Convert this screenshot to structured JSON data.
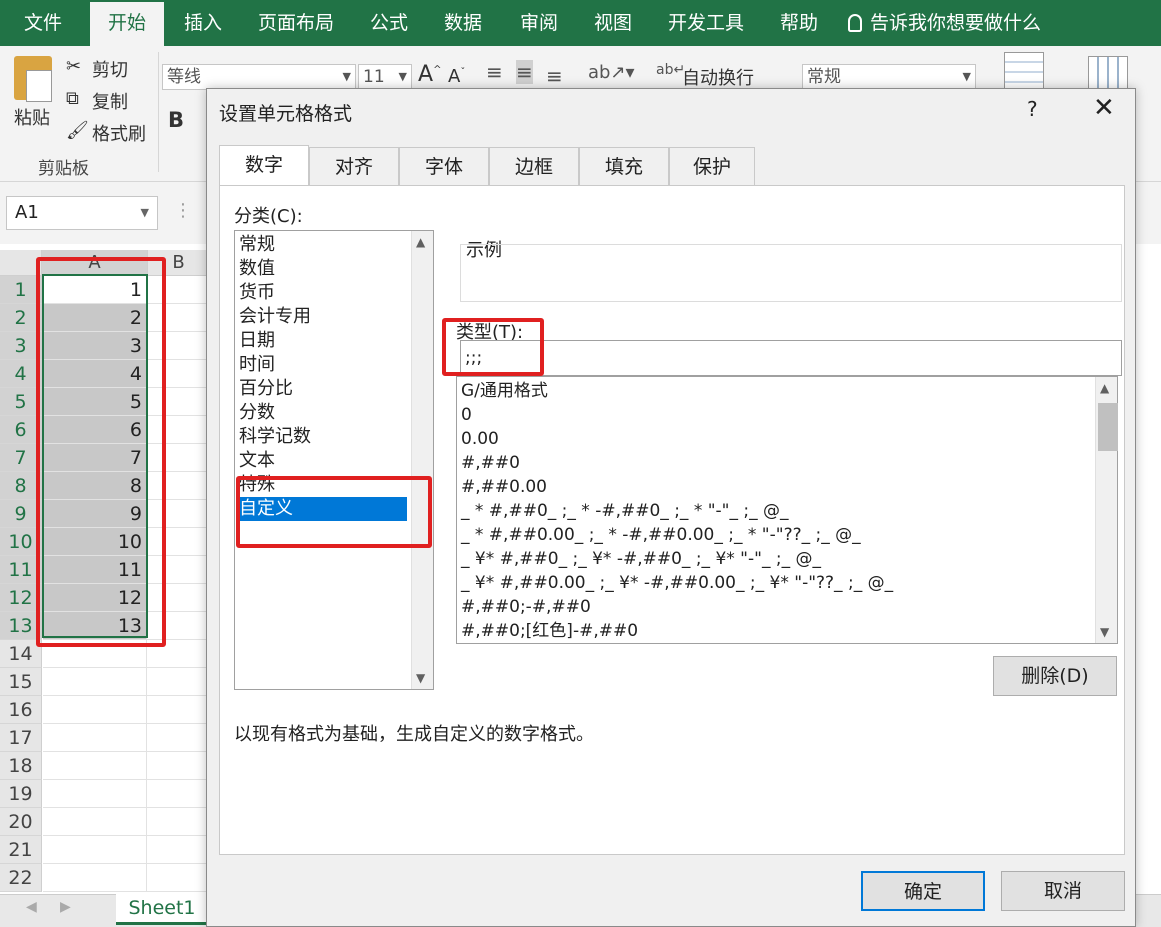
{
  "ribbon": {
    "tabs": [
      "文件",
      "开始",
      "插入",
      "页面布局",
      "公式",
      "数据",
      "审阅",
      "视图",
      "开发工具",
      "帮助"
    ],
    "active_tab": "开始",
    "tell_me": "告诉我你想要做什么",
    "paste_label": "粘贴",
    "cut_label": "剪切",
    "copy_label": "复制",
    "format_painter_label": "格式刷",
    "clipboard_group": "剪贴板",
    "font_name": "等线",
    "font_size": "11",
    "bold": "B",
    "wrap_text": "自动换行",
    "number_format": "常规"
  },
  "formula_bar": {
    "name_box": "A1"
  },
  "grid": {
    "col_a": "A",
    "col_b": "B",
    "rows": [
      "1",
      "2",
      "3",
      "4",
      "5",
      "6",
      "7",
      "8",
      "9",
      "10",
      "11",
      "12",
      "13",
      "14",
      "15",
      "16",
      "17",
      "18",
      "19",
      "20",
      "21",
      "22"
    ],
    "values": [
      "1",
      "2",
      "3",
      "4",
      "5",
      "6",
      "7",
      "8",
      "9",
      "10",
      "11",
      "12",
      "13"
    ]
  },
  "sheet_tab": "Sheet1",
  "dialog": {
    "title": "设置单元格格式",
    "help": "?",
    "tabs": [
      "数字",
      "对齐",
      "字体",
      "边框",
      "填充",
      "保护"
    ],
    "category_label": "分类(C):",
    "categories": [
      "常规",
      "数值",
      "货币",
      "会计专用",
      "日期",
      "时间",
      "百分比",
      "分数",
      "科学记数",
      "文本",
      "特殊",
      "自定义"
    ],
    "selected_category": "自定义",
    "sample_label": "示例",
    "type_label": "类型(T):",
    "type_value": ";;;",
    "formats": [
      "G/通用格式",
      "0",
      "0.00",
      "#,##0",
      "#,##0.00",
      "_ * #,##0_ ;_ * -#,##0_ ;_ * \"-\"_ ;_ @_",
      "_ * #,##0.00_ ;_ * -#,##0.00_ ;_ * \"-\"??_ ;_ @_",
      "_ ¥* #,##0_ ;_ ¥* -#,##0_ ;_ ¥* \"-\"_ ;_ @_",
      "_ ¥* #,##0.00_ ;_ ¥* -#,##0.00_ ;_ ¥* \"-\"??_ ;_ @_",
      "#,##0;-#,##0",
      "#,##0;[红色]-#,##0"
    ],
    "delete_button": "删除(D)",
    "description": "以现有格式为基础，生成自定义的数字格式。",
    "ok_button": "确定",
    "cancel_button": "取消"
  },
  "colors": {
    "excel_green": "#217346",
    "highlight_red": "#e02020",
    "selection_blue": "#0078d7"
  }
}
